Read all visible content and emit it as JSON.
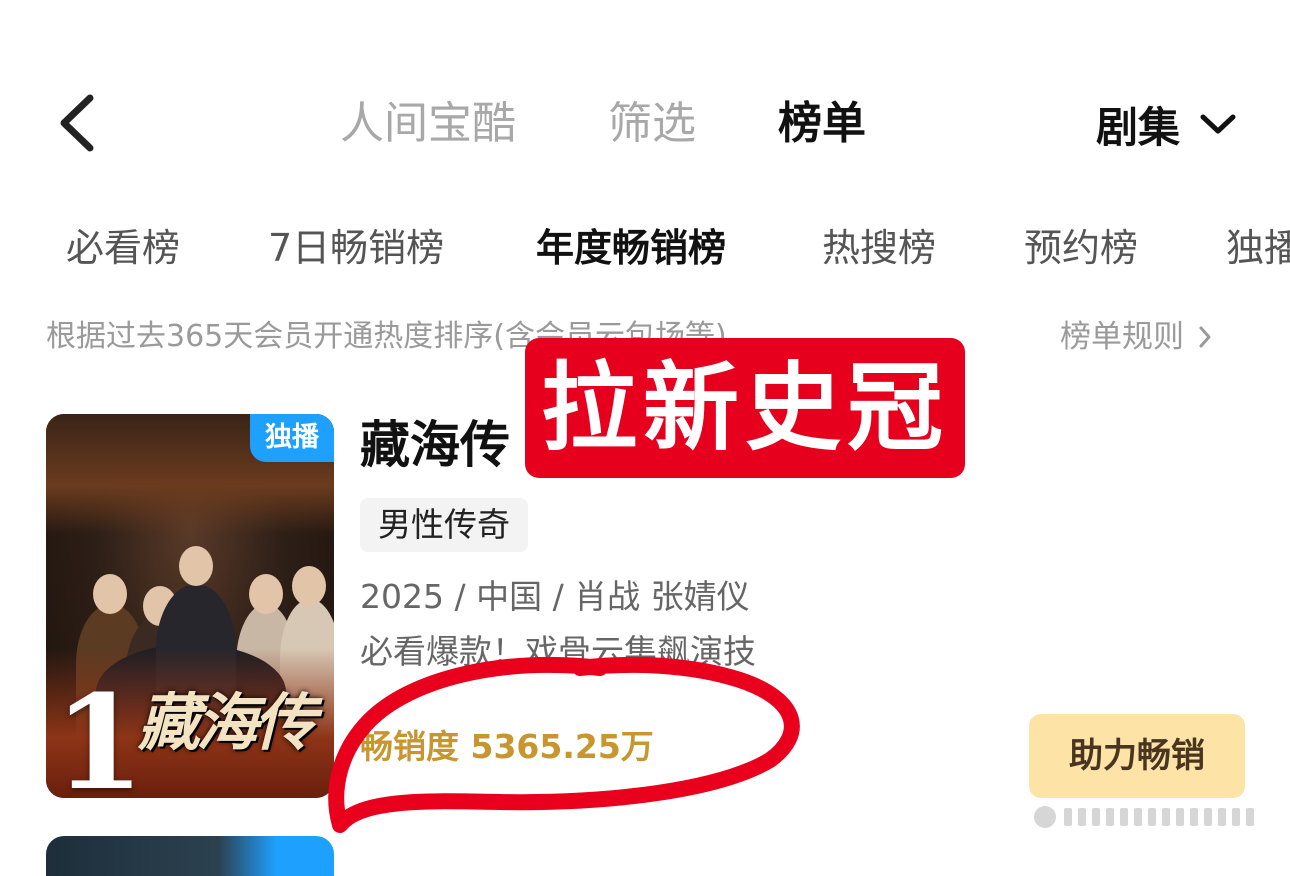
{
  "nav": {
    "tabs": [
      {
        "label": "人间宝酷",
        "active": false
      },
      {
        "label": "筛选",
        "active": false
      },
      {
        "label": "榜单",
        "active": true
      }
    ],
    "category": "剧集",
    "icons": {
      "back": "back-arrow-icon",
      "dropdown": "chevron-down-icon"
    }
  },
  "sub_tabs": [
    {
      "label": "必看榜",
      "active": false
    },
    {
      "label": "7日畅销榜",
      "active": false
    },
    {
      "label": "年度畅销榜",
      "active": true
    },
    {
      "label": "热搜榜",
      "active": false
    },
    {
      "label": "预约榜",
      "active": false
    },
    {
      "label": "独播",
      "active": false
    }
  ],
  "description": "根据过去365天会员开通热度排序(含会员云包场等)",
  "rules_link": "榜单规则",
  "item": {
    "rank": "1",
    "exclusive_badge": "独播",
    "poster_title": "藏海传",
    "title": "藏海传",
    "genre": "男性传奇",
    "meta": "2025 / 中国 / 肖战 张婧仪",
    "slogan": "必看爆款！戏骨云集飙演技",
    "sales_label": "畅销度",
    "sales_value": "5365.25万",
    "action": "助力畅销"
  },
  "overlay_label": "拉新史冠",
  "colors": {
    "accent_gold": "#c8962f",
    "action_bg": "#fde4a6",
    "badge_blue": "#1ea0ff",
    "overlay_red": "#e6001e"
  }
}
